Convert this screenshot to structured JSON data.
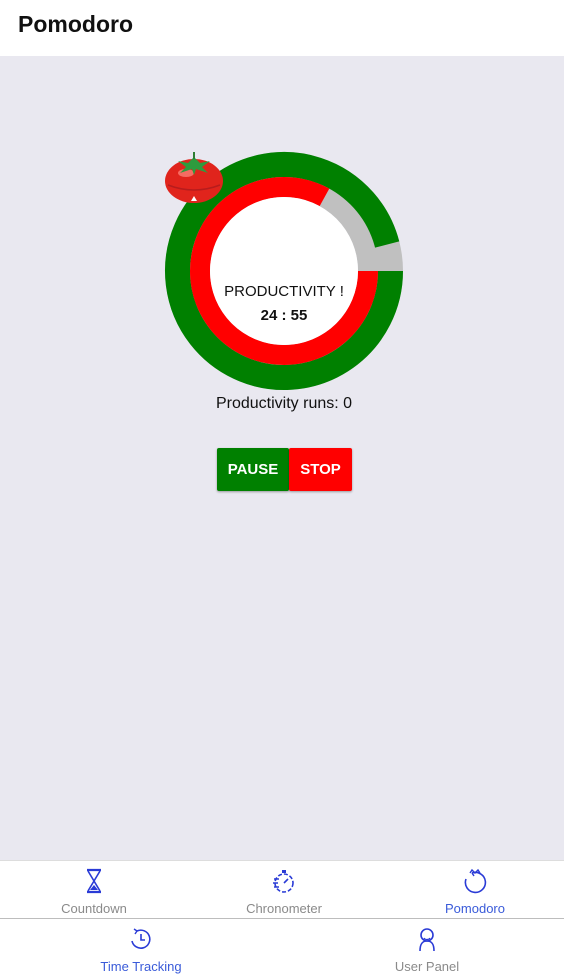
{
  "app": {
    "title": "Pomodoro"
  },
  "timer": {
    "phase_label": "PRODUCTIVITY !",
    "time_display": "24 : 55",
    "runs_label": "Productivity runs: 0",
    "outer_progress_fraction": 0.96,
    "inner_progress_fraction": 0.83,
    "colors": {
      "outer": "#008000",
      "inner": "#ff0000",
      "remaining": "#c0c0c0",
      "center": "#ffffff"
    }
  },
  "controls": {
    "pause_label": "PAUSE",
    "stop_label": "STOP"
  },
  "tabs_row1": [
    {
      "label": "Countdown",
      "icon": "hourglass-icon"
    },
    {
      "label": "Chronometer",
      "icon": "stopwatch-icon"
    },
    {
      "label": "Pomodoro",
      "icon": "tomato-timer-icon",
      "active": true
    }
  ],
  "tabs_row2": [
    {
      "label": "Time Tracking",
      "icon": "clock-icon"
    },
    {
      "label": "User Panel",
      "icon": "user-icon"
    }
  ]
}
